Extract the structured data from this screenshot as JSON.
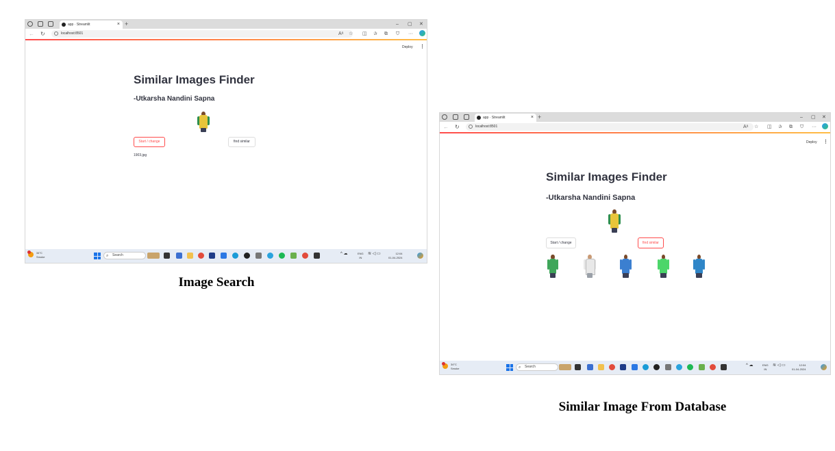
{
  "left_screenshot": {
    "browser": {
      "tab_title": "app · Streamlit",
      "url": "localhost:8501",
      "plus": "+",
      "close": "×"
    },
    "app": {
      "deploy_label": "Deploy",
      "menu_icon": "⋮",
      "title": "Similar Images Finder",
      "subtitle": "-Utkarsha Nandini Sapna",
      "start_button": "Start / change",
      "find_button": "find similar",
      "file_name": "1903.jpg"
    },
    "taskbar": {
      "temp": "34°C",
      "weather": "Smoke",
      "search_placeholder": "Search",
      "lang": "ENG",
      "region": "IN",
      "time": "12:04",
      "date": "01-04-2024"
    }
  },
  "right_screenshot": {
    "browser": {
      "tab_title": "app · Streamlit",
      "url": "localhost:8501",
      "plus": "+",
      "close": "×"
    },
    "app": {
      "deploy_label": "Deploy",
      "menu_icon": "⋮",
      "title": "Similar Images Finder",
      "subtitle": "-Utkarsha Nandini Sapna",
      "start_button": "Start / change",
      "find_button": "find similar",
      "result_colors": [
        "#3fa65a",
        "#e8e8e8",
        "#3b7fd0",
        "#4cd66a",
        "#2f86c8"
      ]
    },
    "taskbar": {
      "temp": "34°C",
      "weather": "Smoke",
      "search_placeholder": "Search",
      "lang": "ENG",
      "region": "IN",
      "time": "12:04",
      "date": "01-04-2024"
    }
  },
  "captions": {
    "left": "Image Search",
    "right": "Similar Image From Database"
  },
  "colors": {
    "streamlit_red": "#ff4b4b",
    "shirt_yellow": "#e8c53a",
    "shirt_green": "#3a9a52"
  }
}
